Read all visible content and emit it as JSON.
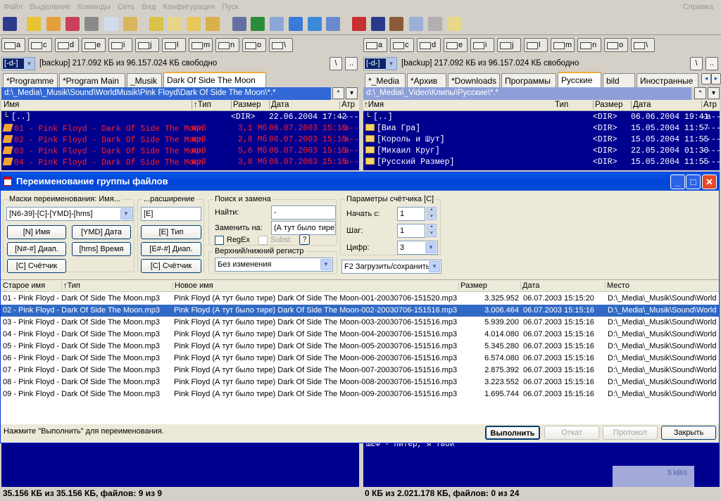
{
  "menu": {
    "items": [
      "Файл",
      "Выделение",
      "Команды",
      "Сеть",
      "Вид",
      "Конфигурация",
      "Пуск"
    ],
    "help": "Справка"
  },
  "left_drives": [
    "a",
    "c",
    "d",
    "e",
    "i",
    "j",
    "l",
    "m",
    "n",
    "o",
    "\\"
  ],
  "right_drives": [
    "a",
    "c",
    "d",
    "e",
    "i",
    "j",
    "l",
    "m",
    "n",
    "o",
    "\\"
  ],
  "left": {
    "drive_label": "[-d-]",
    "info": "[backup]  217.092 КБ из 96.157.024 КБ свободно",
    "root_btn": "\\",
    "up_btn": "..",
    "tabs": [
      "*Programme",
      "*Program Main",
      "_Musik",
      "Dark Of Side The Moon"
    ],
    "path": "d:\\_Media\\_Musik\\Sound\\WorldMusik\\Pink Floyd\\Dark Of Side The Moon\\*.*",
    "path_btn_star": "*",
    "path_btn_down": "▾",
    "cols": {
      "name": "Имя",
      "type": "↑Тип",
      "size": "Размер",
      "date": "Дата",
      "attr": "Атр"
    },
    "rows": [
      {
        "name": "[..]",
        "type": "",
        "size": "<DIR>",
        "date": "22.06.2004 17:42",
        "attr": "----"
      },
      {
        "name": "01 - Pink Floyd - Dark Of Side The Moon",
        "type": "mp3",
        "size": "3,1 Мб",
        "date": "06.07.2003 15:15",
        "attr": "-a--"
      },
      {
        "name": "02 - Pink Floyd - Dark Of Side The Moon",
        "type": "mp3",
        "size": "2,8 Мб",
        "date": "06.07.2003 15:15",
        "attr": "-a--"
      },
      {
        "name": "03 - Pink Floyd - Dark Of Side The Moon",
        "type": "mp3",
        "size": "5,6 Мб",
        "date": "06.07.2003 15:15",
        "attr": "-a--"
      },
      {
        "name": "04 - Pink Floyd - Dark Of Side The Moon",
        "type": "mp3",
        "size": "3,8 Мб",
        "date": "06.07.2003 15:15",
        "attr": "-a--"
      }
    ],
    "status": "35.156 КБ из 35.156 КБ, файлов: 9 из 9"
  },
  "right": {
    "drive_label": "[-d-]",
    "info": "[backup]  217.092 КБ из 96.157.024 КБ свободно",
    "root_btn": "\\",
    "up_btn": "..",
    "tabs": [
      "*_Media",
      "*Архив",
      "*Downloads",
      "Программы",
      "Русские",
      "bild",
      "Иностранные"
    ],
    "tab_scroll_left": "◂",
    "tab_scroll_right": "▸",
    "path": "d:\\_Media\\_Video\\Клипы\\Русские\\*.*",
    "path_btn_star": "*",
    "path_btn_down": "▾",
    "cols": {
      "name": "↑Имя",
      "type": "Тип",
      "size": "Размер",
      "date": "Дата",
      "attr": "Атр"
    },
    "rows": [
      {
        "name": "[..]",
        "size": "<DIR>",
        "date": "06.06.2004 19:41",
        "attr": "-a--"
      },
      {
        "name": "[Виа Гра]",
        "size": "<DIR>",
        "date": "15.05.2004 11:57",
        "attr": "----"
      },
      {
        "name": "[Король и Шут]",
        "size": "<DIR>",
        "date": "15.05.2004 11:55",
        "attr": "----"
      },
      {
        "name": "[Михаил Круг]",
        "size": "<DIR>",
        "date": "22.05.2004 01:30",
        "attr": "----"
      },
      {
        "name": "[Русский Размер]",
        "size": "<DIR>",
        "date": "15.05.2004 11:55",
        "attr": "----"
      }
    ],
    "partial_row": "ШЕФ - Питер, я твой",
    "net_rate": "5 kB/s",
    "status": "0 КБ из 2.021.178 КБ, файлов: 0 из 24"
  },
  "dialog": {
    "title": "Переименование группы файлов",
    "mask_group": "Маски переименования: Имя...",
    "mask_value": "[N6-39]-[C]-[YMD]-[hms]",
    "btn_name": "[N] Имя",
    "btn_date": "[YMD] Дата",
    "btn_range": "[N#-#] Диап.",
    "btn_time": "[hms] Время",
    "btn_counter": "[C] Счётчик",
    "ext_group": "...расширение",
    "ext_value": "[E]",
    "btn_type": "[E] Тип",
    "btn_ext_range": "[E#-#] Диап.",
    "btn_ext_counter": "[C] Счётчик",
    "search_group": "Поиск и замена",
    "find_label": "Найти:",
    "find_value": "-",
    "replace_label": "Заменить на:",
    "replace_value": "(А тут было тире)",
    "regex_label": "RegEx",
    "subst_label": "Subst",
    "help_btn": "?",
    "case_group": "Верхний/нижний регистр",
    "case_value": "Без изменения",
    "counter_group": "Параметры счётчика [C]",
    "start_label": "Начать с:",
    "start_value": "1",
    "step_label": "Шаг:",
    "step_value": "1",
    "digits_label": "Цифр:",
    "digits_value": "3",
    "load_value": "F2 Загрузить/сохранить",
    "cols": {
      "old": "Старое имя",
      "type": "↑Тип",
      "new": "Новое имя",
      "size": "Размер",
      "date": "Дата",
      "place": "Место"
    },
    "rows": [
      {
        "old": "01 - Pink Floyd - Dark Of Side The Moon.mp3",
        "new": "Pink Floyd (А тут было тире) Dark Of Side The Moon-001-20030706-151520.mp3",
        "size": "3.325.952",
        "date": "06.07.2003 15:15:20",
        "place": "D:\\_Media\\_Musik\\Sound\\World"
      },
      {
        "old": "02 - Pink Floyd - Dark Of Side The Moon.mp3",
        "new": "Pink Floyd (А тут было тире) Dark Of Side The Moon-002-20030706-151516.mp3",
        "size": "3.006.464",
        "date": "06.07.2003 15:15:16",
        "place": "D:\\_Media\\_Musik\\Sound\\World"
      },
      {
        "old": "03 - Pink Floyd - Dark Of Side The Moon.mp3",
        "new": "Pink Floyd (А тут было тире) Dark Of Side The Moon-003-20030706-151516.mp3",
        "size": "5.939.200",
        "date": "06.07.2003 15:15:16",
        "place": "D:\\_Media\\_Musik\\Sound\\World"
      },
      {
        "old": "04 - Pink Floyd - Dark Of Side The Moon.mp3",
        "new": "Pink Floyd (А тут было тире) Dark Of Side The Moon-004-20030706-151516.mp3",
        "size": "4.014.080",
        "date": "06.07.2003 15:15:16",
        "place": "D:\\_Media\\_Musik\\Sound\\World"
      },
      {
        "old": "05 - Pink Floyd - Dark Of Side The Moon.mp3",
        "new": "Pink Floyd (А тут было тире) Dark Of Side The Moon-005-20030706-151516.mp3",
        "size": "5.345.280",
        "date": "06.07.2003 15:15:16",
        "place": "D:\\_Media\\_Musik\\Sound\\World"
      },
      {
        "old": "06 - Pink Floyd - Dark Of Side The Moon.mp3",
        "new": "Pink Floyd (А тут было тире) Dark Of Side The Moon-006-20030706-151516.mp3",
        "size": "6.574.080",
        "date": "06.07.2003 15:15:16",
        "place": "D:\\_Media\\_Musik\\Sound\\World"
      },
      {
        "old": "07 - Pink Floyd - Dark Of Side The Moon.mp3",
        "new": "Pink Floyd (А тут было тире) Dark Of Side The Moon-007-20030706-151516.mp3",
        "size": "2.875.392",
        "date": "06.07.2003 15:15:16",
        "place": "D:\\_Media\\_Musik\\Sound\\World"
      },
      {
        "old": "08 - Pink Floyd - Dark Of Side The Moon.mp3",
        "new": "Pink Floyd (А тут было тире) Dark Of Side The Moon-008-20030706-151516.mp3",
        "size": "3.223.552",
        "date": "06.07.2003 15:15:16",
        "place": "D:\\_Media\\_Musik\\Sound\\World"
      },
      {
        "old": "09 - Pink Floyd - Dark Of Side The Moon.mp3",
        "new": "Pink Floyd (А тут было тире) Dark Of Side The Moon-009-20030706-151516.mp3",
        "size": "1.695.744",
        "date": "06.07.2003 15:15:16",
        "place": "D:\\_Media\\_Musik\\Sound\\World"
      }
    ],
    "status": "Нажмите \"Выполнить\" для переименования.",
    "btn_run": "Выполнить",
    "btn_undo": "Откат",
    "btn_log": "Протокол",
    "btn_close": "Закрыть"
  },
  "colors": {
    "panel_bg": "#00008f",
    "selection": "#316ac5",
    "title_blue": "#0a58e8",
    "red_file": "#ff2020"
  }
}
